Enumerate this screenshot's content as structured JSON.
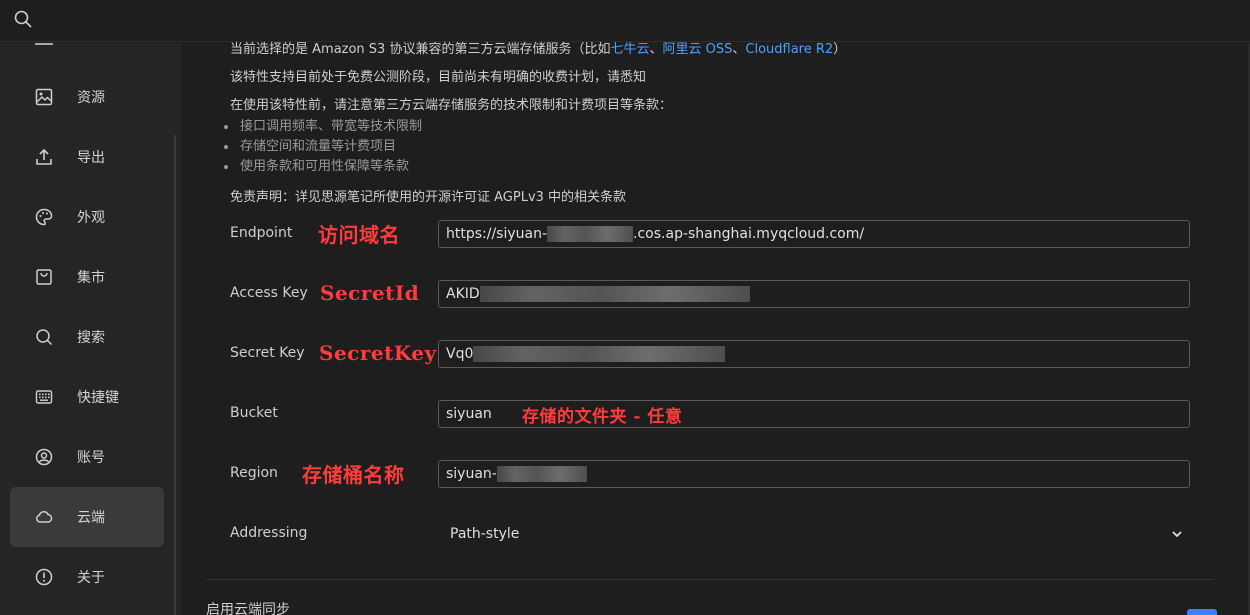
{
  "topbar": {
    "search_icon": "search-icon"
  },
  "sidebar": {
    "items": [
      {
        "label": "资源",
        "icon": "image-icon"
      },
      {
        "label": "导出",
        "icon": "upload-icon"
      },
      {
        "label": "外观",
        "icon": "palette-icon"
      },
      {
        "label": "集市",
        "icon": "bag-icon"
      },
      {
        "label": "搜索",
        "icon": "search-icon"
      },
      {
        "label": "快捷键",
        "icon": "keyboard-icon"
      },
      {
        "label": "账号",
        "icon": "user-icon"
      },
      {
        "label": "云端",
        "icon": "cloud-icon",
        "active": true
      },
      {
        "label": "关于",
        "icon": "info-icon"
      }
    ]
  },
  "intro": {
    "line1_prefix": "当前选择的是 Amazon S3 协议兼容的第三方云端存储服务（比如",
    "link1": "七牛云",
    "sep1": "、",
    "link2": "阿里云 OSS",
    "sep2": "、",
    "link3": "Cloudflare R2",
    "line1_suffix": "）",
    "line2": "该特性支持目前处于免费公测阶段，目前尚未有明确的收费计划，请悉知",
    "line3": "在使用该特性前，请注意第三方云端存储服务的技术限制和计费项目等条款：",
    "bullets": [
      "接口调用频率、带宽等技术限制",
      "存储空间和流量等计费项目",
      "使用条款和可用性保障等条款"
    ],
    "disclaimer": "免责声明：详见思源笔记所使用的开源许可证 AGPLv3 中的相关条款"
  },
  "form": {
    "endpoint": {
      "label": "Endpoint",
      "annotation": "访问域名",
      "value_prefix": "https://siyuan-",
      "value_suffix": ".cos.ap-shanghai.myqcloud.com/"
    },
    "access_key": {
      "label": "Access Key",
      "annotation": "SecretId",
      "value_prefix": "AKID"
    },
    "secret_key": {
      "label": "Secret Key",
      "annotation": "SecretKey",
      "value_prefix": "Vq0"
    },
    "bucket": {
      "label": "Bucket",
      "value": "siyuan",
      "annotation": "存储的文件夹 - 任意"
    },
    "region": {
      "label": "Region",
      "annotation": "存储桶名称",
      "value_prefix": "siyuan-"
    },
    "addressing": {
      "label": "Addressing",
      "value": "Path-style"
    }
  },
  "sync": {
    "label": "启用云端同步"
  },
  "colors": {
    "accent": "#3b82f6",
    "link": "#4aa0ff",
    "annotation": "#ff3b3b",
    "active_bg": "#3a3a3a"
  }
}
